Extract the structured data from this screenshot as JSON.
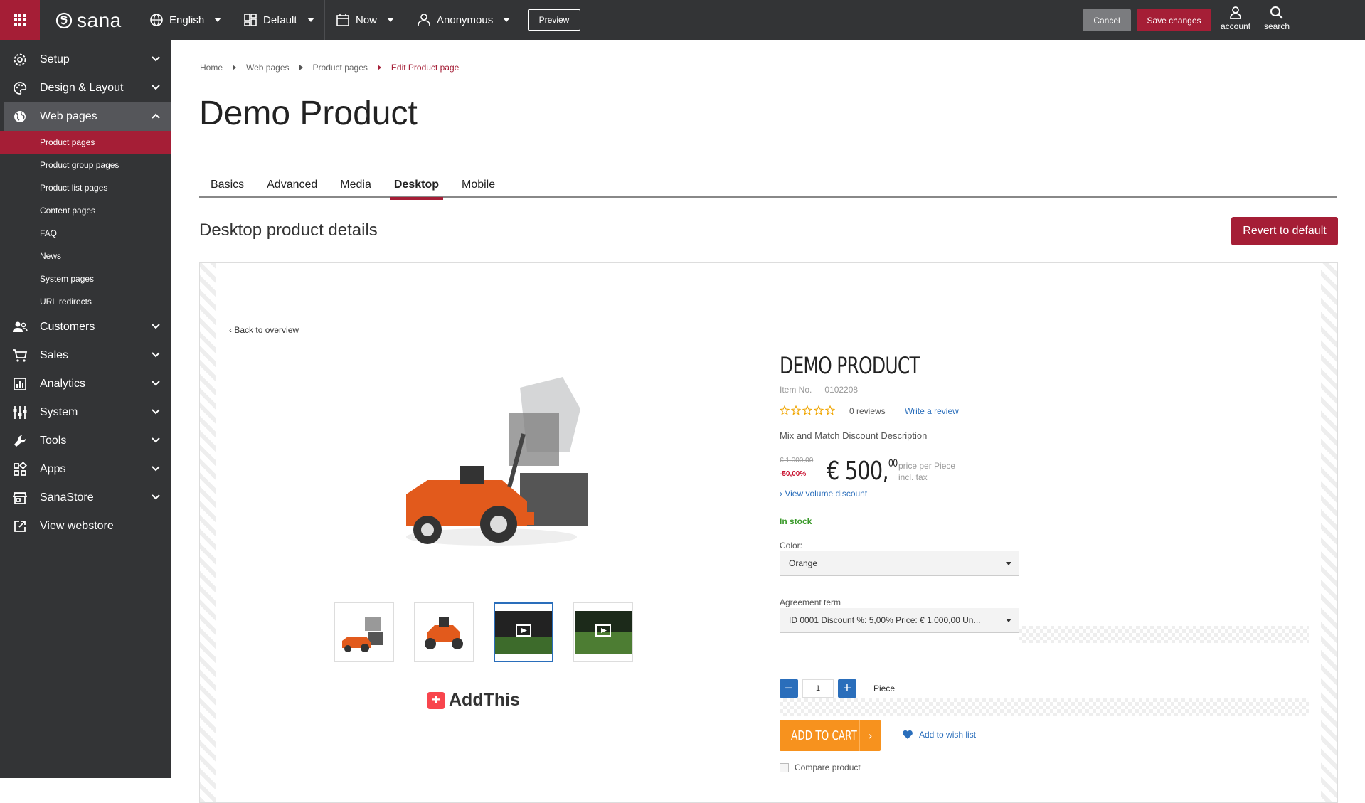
{
  "topbar": {
    "logo": "sana",
    "language": "English",
    "layout": "Default",
    "date": "Now",
    "user": "Anonymous",
    "preview_label": "Preview",
    "cancel_label": "Cancel",
    "save_label": "Save changes",
    "account_label": "account",
    "search_label": "search"
  },
  "sidebar": {
    "items": [
      {
        "label": "Setup",
        "icon": "gear-icon"
      },
      {
        "label": "Design & Layout",
        "icon": "palette-icon"
      },
      {
        "label": "Web pages",
        "icon": "globe-icon"
      },
      {
        "label": "Customers",
        "icon": "users-icon"
      },
      {
        "label": "Sales",
        "icon": "cart-icon"
      },
      {
        "label": "Analytics",
        "icon": "chart-icon"
      },
      {
        "label": "System",
        "icon": "sliders-icon"
      },
      {
        "label": "Tools",
        "icon": "wrench-icon"
      },
      {
        "label": "Apps",
        "icon": "apps-icon"
      },
      {
        "label": "SanaStore",
        "icon": "store-icon"
      },
      {
        "label": "View webstore",
        "icon": "external-link-icon"
      }
    ],
    "subitems": [
      "Product pages",
      "Product group pages",
      "Product list pages",
      "Content pages",
      "FAQ",
      "News",
      "System pages",
      "URL redirects"
    ]
  },
  "breadcrumb": [
    "Home",
    "Web pages",
    "Product pages",
    "Edit Product page"
  ],
  "page_title": "Demo Product",
  "tabs": [
    "Basics",
    "Advanced",
    "Media",
    "Desktop",
    "Mobile"
  ],
  "section_title": "Desktop product details",
  "revert_label": "Revert to default",
  "preview": {
    "back_link": "Back to overview",
    "addthis": "AddThis",
    "product_title": "DEMO PRODUCT",
    "item_no_label": "Item No.",
    "item_no": "0102208",
    "reviews": "0 reviews",
    "write_review": "Write a review",
    "mix_match": "Mix and Match Discount Description",
    "old_price": "€ 1.000,00",
    "discount": "-50,00%",
    "price_main": "€ 500,",
    "price_cents": "00",
    "price_per": "price per Piece",
    "tax": "incl. tax",
    "volume_discount": "› View volume discount",
    "stock": "In stock",
    "color_label": "Color:",
    "color_value": "Orange",
    "agreement_label": "Agreement term",
    "agreement_value": "ID 0001 Discount %: 5,00% Price: € 1.000,00 Un...",
    "qty_value": "1",
    "qty_unit": "Piece",
    "add_to_cart": "ADD TO CART",
    "wish_list": "Add to wish list",
    "compare": "Compare product"
  },
  "colors": {
    "brand": "#a51e36",
    "dark": "#333436",
    "link": "#2a6ebb",
    "cart": "#f7921e",
    "stock": "#3a9a2a"
  }
}
